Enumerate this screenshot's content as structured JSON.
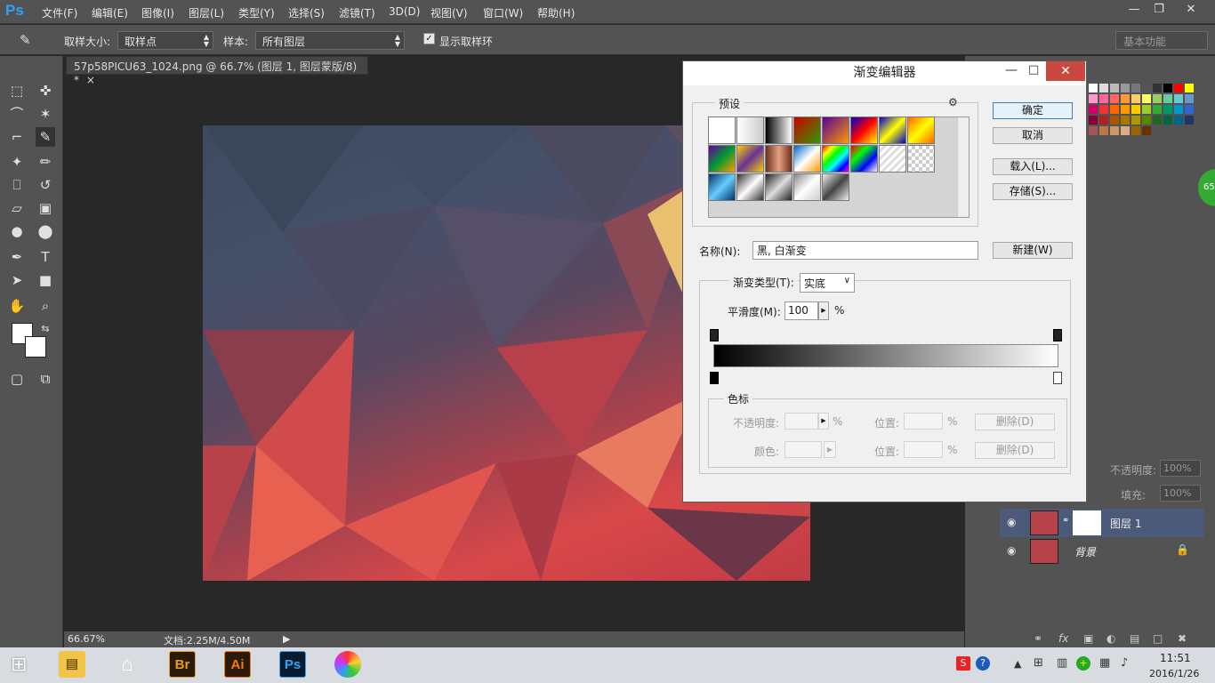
{
  "app": {
    "logo": "Ps",
    "menus": [
      "文件(F)",
      "编辑(E)",
      "图像(I)",
      "图层(L)",
      "类型(Y)",
      "选择(S)",
      "滤镜(T)",
      "3D(D)",
      "视图(V)",
      "窗口(W)",
      "帮助(H)"
    ],
    "window_controls": [
      "minimize-icon",
      "restore-icon",
      "close-icon"
    ]
  },
  "options": {
    "sample_size_label": "取样大小:",
    "sample_size_value": "取样点",
    "sample_label": "样本:",
    "sample_value": "所有图层",
    "show_ring_label": "显示取样环",
    "show_ring_checked": true,
    "workspace": "基本功能"
  },
  "document": {
    "tab_title": "57p58PICU63_1024.png @ 66.7% (图层 1, 图层蒙版/8) *",
    "close": "×"
  },
  "status": {
    "zoom": "66.67%",
    "doc_info": "文档:2.25M/4.50M"
  },
  "dialog": {
    "title": "渐变编辑器",
    "presets_label": "预设",
    "ok": "确定",
    "cancel": "取消",
    "load": "载入(L)...",
    "save": "存储(S)...",
    "name_label": "名称(N):",
    "name_value": "黑, 白渐变",
    "new": "新建(W)",
    "type_label": "渐变类型(T):",
    "type_value": "实底",
    "smooth_label": "平滑度(M):",
    "smooth_value": "100",
    "percent": "%",
    "stops_label": "色标",
    "opacity_label": "不透明度:",
    "location_label": "位置:",
    "delete_label": "删除(D)",
    "color_label": "颜色:"
  },
  "layers": {
    "opacity_label": "不透明度:",
    "opacity_value": "100%",
    "fill_label": "填充:",
    "fill_value": "100%",
    "items": [
      {
        "name": "图层 1"
      },
      {
        "name": "背景"
      }
    ]
  },
  "taskbar": {
    "time": "11:51",
    "date": "2016/1/26",
    "apps": [
      "Br",
      "Ai",
      "Ps"
    ]
  },
  "colors": {
    "accent": "#2fa3f5",
    "dialog_bg": "#f0f0f0"
  }
}
